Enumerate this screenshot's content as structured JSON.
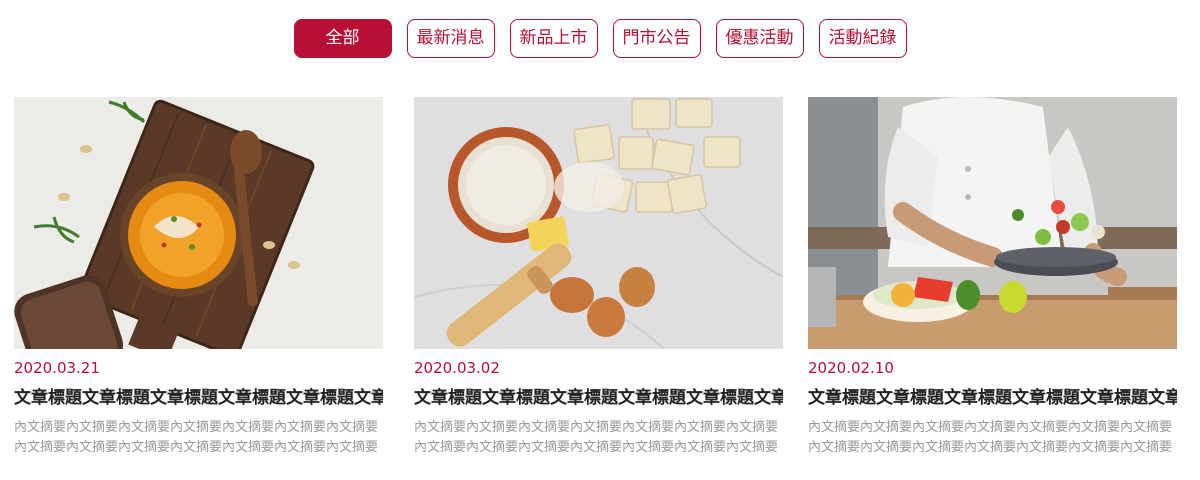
{
  "tabs": [
    {
      "label": "全部"
    },
    {
      "label": "最新消息"
    },
    {
      "label": "新品上市"
    },
    {
      "label": "門市公告"
    },
    {
      "label": "優惠活動"
    },
    {
      "label": "活動紀錄"
    }
  ],
  "active_tab": 0,
  "accent_color": "#b80f35",
  "articles": [
    {
      "date": "2020.03.21",
      "title": "文章標題文章標題文章標題文章標題文章標題文章標題",
      "excerpt": "內文摘要內文摘要內文摘要內文摘要內文摘要內文摘要內文摘要內文摘要內文摘要內文摘要內文摘要內文摘要內文摘要內文摘要",
      "image": "pumpkin-soup-photo"
    },
    {
      "date": "2020.03.02",
      "title": "文章標題文章標題文章標題文章標題文章標題文章標題",
      "excerpt": "內文摘要內文摘要內文摘要內文摘要內文摘要內文摘要內文摘要內文摘要內文摘要內文摘要內文摘要內文摘要內文摘要內文摘要",
      "image": "ravioli-dough-photo"
    },
    {
      "date": "2020.02.10",
      "title": "文章標題文章標題文章標題文章標題文章標題文章標題",
      "excerpt": "內文摘要內文摘要內文摘要內文摘要內文摘要內文摘要內文摘要內文摘要內文摘要內文摘要內文摘要內文摘要內文摘要內文摘要",
      "image": "chef-cooking-photo"
    }
  ]
}
